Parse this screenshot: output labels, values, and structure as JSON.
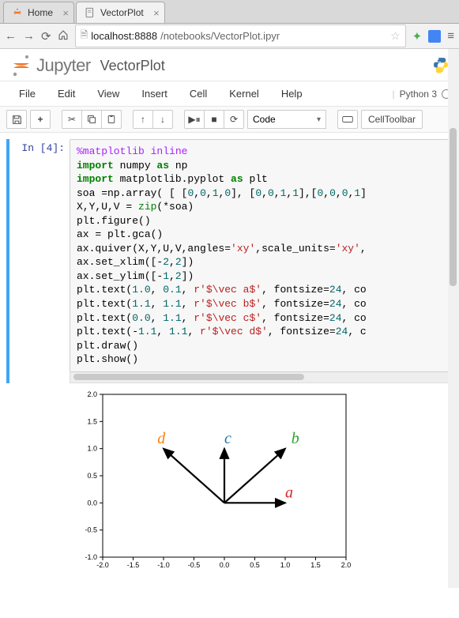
{
  "browser": {
    "tabs": [
      {
        "title": "Home"
      },
      {
        "title": "VectorPlot"
      }
    ],
    "url_host": "localhost",
    "url_port": ":8888",
    "url_path": "/notebooks/VectorPlot.ipyr"
  },
  "header": {
    "logo_text": "Jupyter",
    "notebook_name": "VectorPlot"
  },
  "menubar": {
    "items": [
      "File",
      "Edit",
      "View",
      "Insert",
      "Cell",
      "Kernel",
      "Help"
    ],
    "kernel_name": "Python 3"
  },
  "toolbar": {
    "celltype": "Code",
    "celltoolbar_label": "CellToolbar"
  },
  "cell": {
    "prompt_label": "In [4]:",
    "code_lines": [
      [
        {
          "t": "%matplotlib inline",
          "c": "cm-magic"
        }
      ],
      [
        {
          "t": "import",
          "c": "cm-keyword"
        },
        {
          "t": " numpy "
        },
        {
          "t": "as",
          "c": "cm-keyword"
        },
        {
          "t": " np"
        }
      ],
      [
        {
          "t": "import",
          "c": "cm-keyword"
        },
        {
          "t": " matplotlib.pyplot "
        },
        {
          "t": "as",
          "c": "cm-keyword"
        },
        {
          "t": " plt"
        }
      ],
      [
        {
          "t": "soa =np.array( [ ["
        },
        {
          "t": "0",
          "c": "cm-number"
        },
        {
          "t": ","
        },
        {
          "t": "0",
          "c": "cm-number"
        },
        {
          "t": ","
        },
        {
          "t": "1",
          "c": "cm-number"
        },
        {
          "t": ","
        },
        {
          "t": "0",
          "c": "cm-number"
        },
        {
          "t": "], ["
        },
        {
          "t": "0",
          "c": "cm-number"
        },
        {
          "t": ","
        },
        {
          "t": "0",
          "c": "cm-number"
        },
        {
          "t": ","
        },
        {
          "t": "1",
          "c": "cm-number"
        },
        {
          "t": ","
        },
        {
          "t": "1",
          "c": "cm-number"
        },
        {
          "t": "],["
        },
        {
          "t": "0",
          "c": "cm-number"
        },
        {
          "t": ","
        },
        {
          "t": "0",
          "c": "cm-number"
        },
        {
          "t": ","
        },
        {
          "t": "0",
          "c": "cm-number"
        },
        {
          "t": ","
        },
        {
          "t": "1",
          "c": "cm-number"
        },
        {
          "t": "]"
        }
      ],
      [
        {
          "t": "X,Y,U,V = "
        },
        {
          "t": "zip",
          "c": "cm-builtin"
        },
        {
          "t": "(*soa)"
        }
      ],
      [
        {
          "t": "plt.figure()"
        }
      ],
      [
        {
          "t": "ax = plt.gca()"
        }
      ],
      [
        {
          "t": "ax.quiver(X,Y,U,V,angles="
        },
        {
          "t": "'xy'",
          "c": "cm-string"
        },
        {
          "t": ",scale_units="
        },
        {
          "t": "'xy'",
          "c": "cm-string"
        },
        {
          "t": ","
        }
      ],
      [
        {
          "t": "ax.set_xlim([-"
        },
        {
          "t": "2",
          "c": "cm-number"
        },
        {
          "t": ","
        },
        {
          "t": "2",
          "c": "cm-number"
        },
        {
          "t": "])"
        }
      ],
      [
        {
          "t": "ax.set_ylim([-"
        },
        {
          "t": "1",
          "c": "cm-number"
        },
        {
          "t": ","
        },
        {
          "t": "2",
          "c": "cm-number"
        },
        {
          "t": "])"
        }
      ],
      [
        {
          "t": "plt.text("
        },
        {
          "t": "1.0",
          "c": "cm-number"
        },
        {
          "t": ", "
        },
        {
          "t": "0.1",
          "c": "cm-number"
        },
        {
          "t": ", "
        },
        {
          "t": "r'$\\vec a$'",
          "c": "cm-string"
        },
        {
          "t": ", fontsize="
        },
        {
          "t": "24",
          "c": "cm-number"
        },
        {
          "t": ", co"
        }
      ],
      [
        {
          "t": "plt.text("
        },
        {
          "t": "1.1",
          "c": "cm-number"
        },
        {
          "t": ", "
        },
        {
          "t": "1.1",
          "c": "cm-number"
        },
        {
          "t": ", "
        },
        {
          "t": "r'$\\vec b$'",
          "c": "cm-string"
        },
        {
          "t": ", fontsize="
        },
        {
          "t": "24",
          "c": "cm-number"
        },
        {
          "t": ", co"
        }
      ],
      [
        {
          "t": "plt.text("
        },
        {
          "t": "0.0",
          "c": "cm-number"
        },
        {
          "t": ", "
        },
        {
          "t": "1.1",
          "c": "cm-number"
        },
        {
          "t": ", "
        },
        {
          "t": "r'$\\vec c$'",
          "c": "cm-string"
        },
        {
          "t": ", fontsize="
        },
        {
          "t": "24",
          "c": "cm-number"
        },
        {
          "t": ", co"
        }
      ],
      [
        {
          "t": "plt.text(-"
        },
        {
          "t": "1.1",
          "c": "cm-number"
        },
        {
          "t": ", "
        },
        {
          "t": "1.1",
          "c": "cm-number"
        },
        {
          "t": ", "
        },
        {
          "t": "r'$\\vec d$'",
          "c": "cm-string"
        },
        {
          "t": ", fontsize="
        },
        {
          "t": "24",
          "c": "cm-number"
        },
        {
          "t": ", c"
        }
      ],
      [
        {
          "t": "plt.draw()"
        }
      ],
      [
        {
          "t": "plt.show()"
        }
      ]
    ]
  },
  "chart_data": {
    "type": "quiver",
    "title": "",
    "xlabel": "",
    "ylabel": "",
    "xlim": [
      -2,
      2
    ],
    "ylim": [
      -1,
      2
    ],
    "xticks": [
      -2.0,
      -1.5,
      -1.0,
      -0.5,
      0.0,
      0.5,
      1.0,
      1.5,
      2.0
    ],
    "yticks": [
      -1.0,
      -0.5,
      0.0,
      0.5,
      1.0,
      1.5,
      2.0
    ],
    "vectors": [
      {
        "x": 0,
        "y": 0,
        "u": 1,
        "v": 0
      },
      {
        "x": 0,
        "y": 0,
        "u": 1,
        "v": 1
      },
      {
        "x": 0,
        "y": 0,
        "u": 0,
        "v": 1
      },
      {
        "x": 0,
        "y": 0,
        "u": -1,
        "v": 1
      }
    ],
    "annotations": [
      {
        "x": 1.0,
        "y": 0.1,
        "text": "a⃗",
        "color": "#d62728"
      },
      {
        "x": 1.1,
        "y": 1.1,
        "text": "b⃗",
        "color": "#2ca02c"
      },
      {
        "x": 0.0,
        "y": 1.1,
        "text": "c⃗",
        "color": "#1f77b4"
      },
      {
        "x": -1.1,
        "y": 1.1,
        "text": "d⃗",
        "color": "#ff7f0e"
      }
    ]
  }
}
